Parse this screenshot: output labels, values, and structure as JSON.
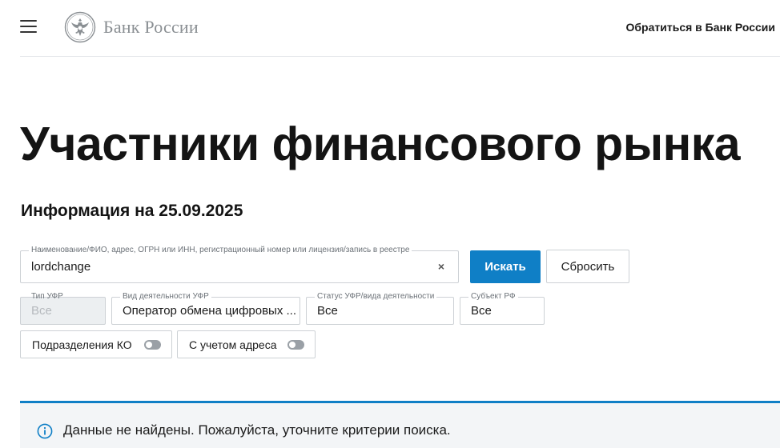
{
  "header": {
    "logo_text": "Банк России",
    "contact_link": "Обратиться в Банк России"
  },
  "page": {
    "title": "Участники финансового рынка",
    "info_date": "Информация на 25.09.2025"
  },
  "search": {
    "label": "Наименование/ФИО, адрес, ОГРН или ИНН, регистрационный номер или лицензия/запись в реестре",
    "value": "lordchange",
    "clear_glyph": "×",
    "search_button": "Искать",
    "reset_button": "Сбросить"
  },
  "filters": {
    "type": {
      "label": "Тип УФР",
      "value": "Все",
      "disabled": true
    },
    "activity": {
      "label": "Вид деятельности УФР",
      "value": "Оператор обмена цифровых ..."
    },
    "status": {
      "label": "Статус УФР/вида деятельности",
      "value": "Все"
    },
    "subject": {
      "label": "Субъект РФ",
      "value": "Все"
    }
  },
  "toggles": {
    "ko_divisions": {
      "label": "Подразделения КО",
      "on": false
    },
    "with_address": {
      "label": "С учетом адреса",
      "on": false
    }
  },
  "notice": {
    "text": "Данные не найдены. Пожалуйста, уточните критерии поиска.",
    "icon": "info-icon"
  },
  "colors": {
    "accent": "#0f7fc6",
    "logo_gray": "#8a8f93",
    "notice_bg": "#f3f5f7"
  }
}
